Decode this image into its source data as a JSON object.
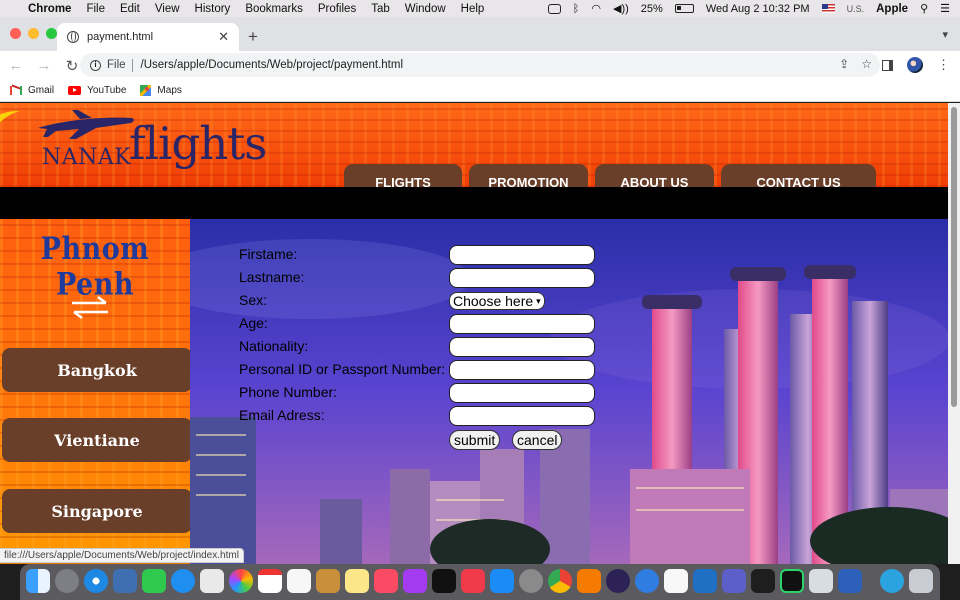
{
  "menubar": {
    "app_name": "Chrome",
    "items": [
      "File",
      "Edit",
      "View",
      "History",
      "Bookmarks",
      "Profiles",
      "Tab",
      "Window",
      "Help"
    ],
    "battery": "25%",
    "datetime": "Wed Aug 2  10:32 PM",
    "input_source": "U.S.",
    "user": "Apple"
  },
  "browser": {
    "tab_title": "payment.html",
    "address_scheme": "File",
    "address_path": "/Users/apple/Documents/Web/project/payment.html",
    "bookmarks": [
      "Gmail",
      "YouTube",
      "Maps"
    ],
    "status_url": "file:///Users/apple/Documents/Web/project/index.html"
  },
  "site": {
    "logo_prefix": "NANAK",
    "logo_main": "flights",
    "nav": [
      "FLIGHTS",
      "PROMOTION",
      "ABOUT US",
      "CONTACT US"
    ],
    "origin_city": "Phnom Penh",
    "swap_icon": "swap-arrows-icon",
    "destinations": [
      "Bangkok",
      "Vientiane",
      "Singapore"
    ]
  },
  "form": {
    "fields": [
      {
        "label": "Firstame:",
        "type": "text",
        "value": ""
      },
      {
        "label": "Lastname:",
        "type": "text",
        "value": ""
      },
      {
        "label": "Sex:",
        "type": "select",
        "value": "Choose here"
      },
      {
        "label": "Age:",
        "type": "text",
        "value": ""
      },
      {
        "label": "Nationality:",
        "type": "text",
        "value": ""
      },
      {
        "label": "Personal ID or Passport Number:",
        "type": "text",
        "value": ""
      },
      {
        "label": "Phone Number:",
        "type": "text",
        "value": ""
      },
      {
        "label": "Email Adress:",
        "type": "text",
        "value": ""
      }
    ],
    "submit_label": "submit",
    "cancel_label": "cancel"
  },
  "colors": {
    "header_orange": "#ff5a10",
    "button_brown": "#6a3f2a",
    "logo_navy": "#2a2566",
    "city_blue": "#1f3a9a",
    "crescent_yellow": "#fbd108"
  }
}
